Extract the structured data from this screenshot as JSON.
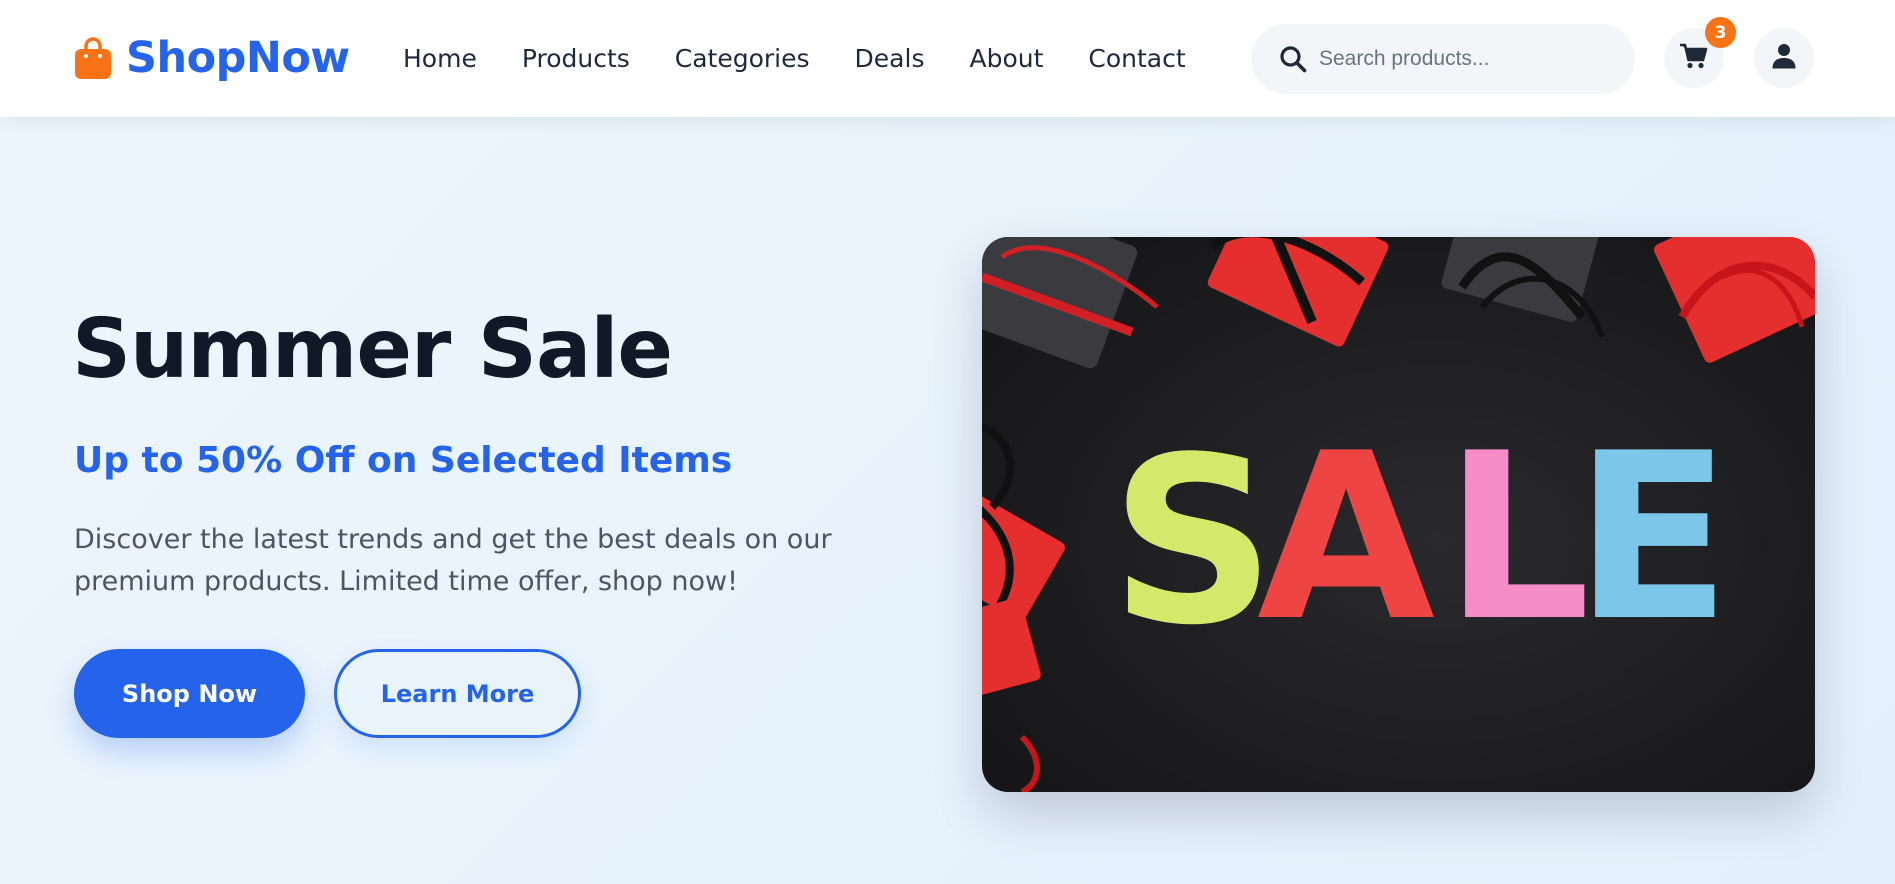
{
  "brand": {
    "name": "ShopNow",
    "icon": "shopping-bag-icon",
    "icon_color": "#f97316",
    "color": "#2563eb"
  },
  "nav": {
    "items": [
      {
        "label": "Home"
      },
      {
        "label": "Products"
      },
      {
        "label": "Categories"
      },
      {
        "label": "Deals"
      },
      {
        "label": "About"
      },
      {
        "label": "Contact"
      }
    ]
  },
  "search": {
    "placeholder": "Search products...",
    "value": "",
    "icon": "search-icon"
  },
  "cart": {
    "icon": "cart-icon",
    "count": "3",
    "badge_color": "#f97316"
  },
  "user": {
    "icon": "user-icon"
  },
  "hero": {
    "title": "Summer Sale",
    "subtitle": "Up to 50% Off on Selected Items",
    "description": "Discover the latest trends and get the best deals on our premium products. Limited time offer, shop now!",
    "primary_button": "Shop Now",
    "secondary_button": "Learn More",
    "accent_color": "#2563eb",
    "image": {
      "subject": "sale-banner-photo",
      "letters": [
        {
          "char": "S",
          "color": "#d4e96a"
        },
        {
          "char": "A",
          "color": "#ef4444"
        },
        {
          "char": "L",
          "color": "#f58bc7"
        },
        {
          "char": "E",
          "color": "#7cc6ea"
        }
      ]
    }
  }
}
